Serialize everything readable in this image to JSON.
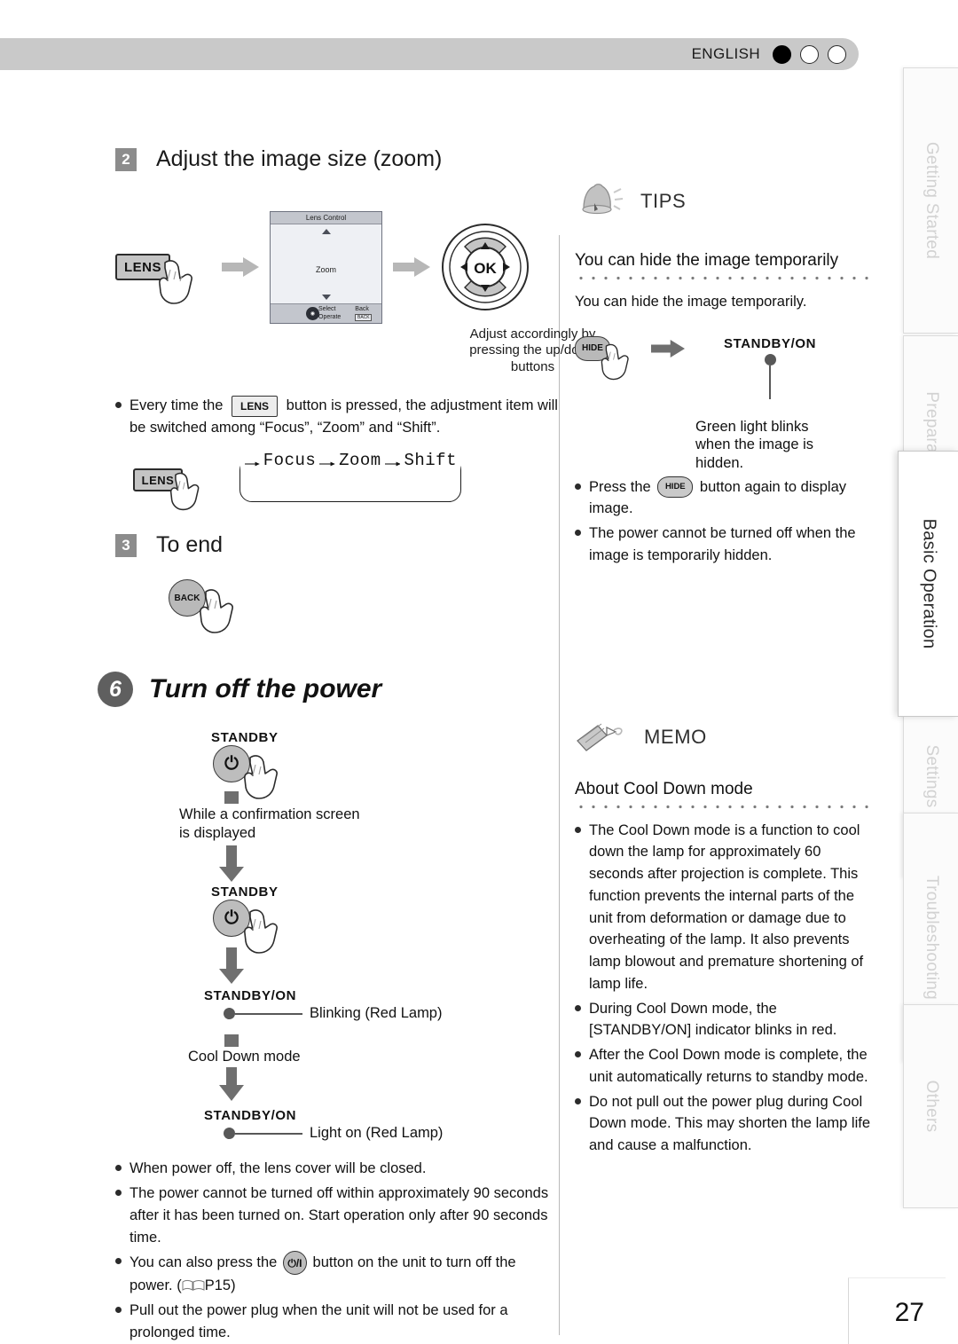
{
  "header": {
    "language": "ENGLISH",
    "dots": [
      "filled",
      "empty",
      "empty"
    ]
  },
  "side_tabs": [
    {
      "label": "Getting Started",
      "active": false
    },
    {
      "label": "Preparation",
      "active": false
    },
    {
      "label": "Basic Operation",
      "active": true
    },
    {
      "label": "Settings",
      "active": false
    },
    {
      "label": "Troubleshooting",
      "active": false
    },
    {
      "label": "Others",
      "active": false
    }
  ],
  "left": {
    "step2": {
      "number": "2",
      "title": "Adjust the image size (zoom)",
      "lens_button": "LENS",
      "osd": {
        "title": "Lens Control",
        "item": "Zoom",
        "foot_select": "Select",
        "foot_operate": "Operate",
        "foot_back": "Back",
        "foot_backkey": "BACK"
      },
      "dpad_ok": "OK",
      "dpad_caption": "Adjust accordingly by pressing the up/down buttons",
      "note_part1": "Every time the",
      "note_lens": "LENS",
      "note_part2": "button is pressed, the adjustment item will be switched among “Focus”, “Zoom” and “Shift”.",
      "loop_lens_button": "LENS",
      "loop_items": [
        "Focus",
        "Zoom",
        "Shift"
      ]
    },
    "step3": {
      "number": "3",
      "title": "To end",
      "back_button": "BACK"
    },
    "step6": {
      "number": "6",
      "title": "Turn off the power",
      "flow": [
        {
          "label": "STANDBY",
          "kind": "button"
        },
        {
          "text": "While a confirmation screen is displayed",
          "kind": "note"
        },
        {
          "label": "STANDBY",
          "kind": "button"
        },
        {
          "label": "STANDBY/ON",
          "kind": "indicator",
          "note": "Blinking (Red Lamp)"
        },
        {
          "text": "Cool Down mode",
          "kind": "note"
        },
        {
          "label": "STANDBY/ON",
          "kind": "indicator",
          "note": "Light on (Red Lamp)"
        }
      ],
      "bullets": [
        "When power off, the lens cover will be closed.",
        "The power cannot be turned off within approximately 90 seconds after it has been turned on. Start operation only after 90 seconds time.",
        "Pull out the power plug when the unit will not be used for a prolonged time."
      ],
      "bullet_power_pre": "You can also press the",
      "bullet_power_post": "button on the unit to turn off the power. (",
      "bullet_power_page": "P15",
      "bullet_power_end": ")",
      "power_glyph": "⏻/I"
    }
  },
  "right": {
    "tips": {
      "title": "TIPS",
      "subtitle": "You can hide the image temporarily",
      "body": "You can hide the image temporarily.",
      "hide_button": "HIDE",
      "indicator_label": "STANDBY/ON",
      "indicator_note": "Green light blinks when the image is hidden.",
      "bullet_hide_pre": "Press the",
      "bullet_hide_btn": "HIDE",
      "bullet_hide_post": "button again to display image.",
      "bullet2": "The power cannot be turned off when the image is temporarily hidden."
    },
    "memo": {
      "title": "MEMO",
      "subtitle": "About Cool Down mode",
      "bullets": [
        "The Cool Down mode is a function to cool down the lamp for approximately 60 seconds after projection is complete. This function prevents the internal parts of the unit from deformation or damage due to overheating of the lamp. It also prevents lamp blowout and premature shortening of lamp life.",
        "During Cool Down mode, the [STANDBY/ON] indicator blinks in red.",
        "After the Cool Down mode is complete, the unit automatically returns to standby mode.",
        "Do not pull out the power plug during Cool Down mode. This may shorten the lamp life and cause a malfunction."
      ]
    }
  },
  "footer": {
    "page_number": "27"
  },
  "colors": {
    "bar": "#c9c9c9",
    "step_badge": "#8c8c8c",
    "arrow": "#7a7a7a",
    "active_tab_text": "#2b2b2b",
    "inactive_tab_text": "#d2d2d2"
  }
}
